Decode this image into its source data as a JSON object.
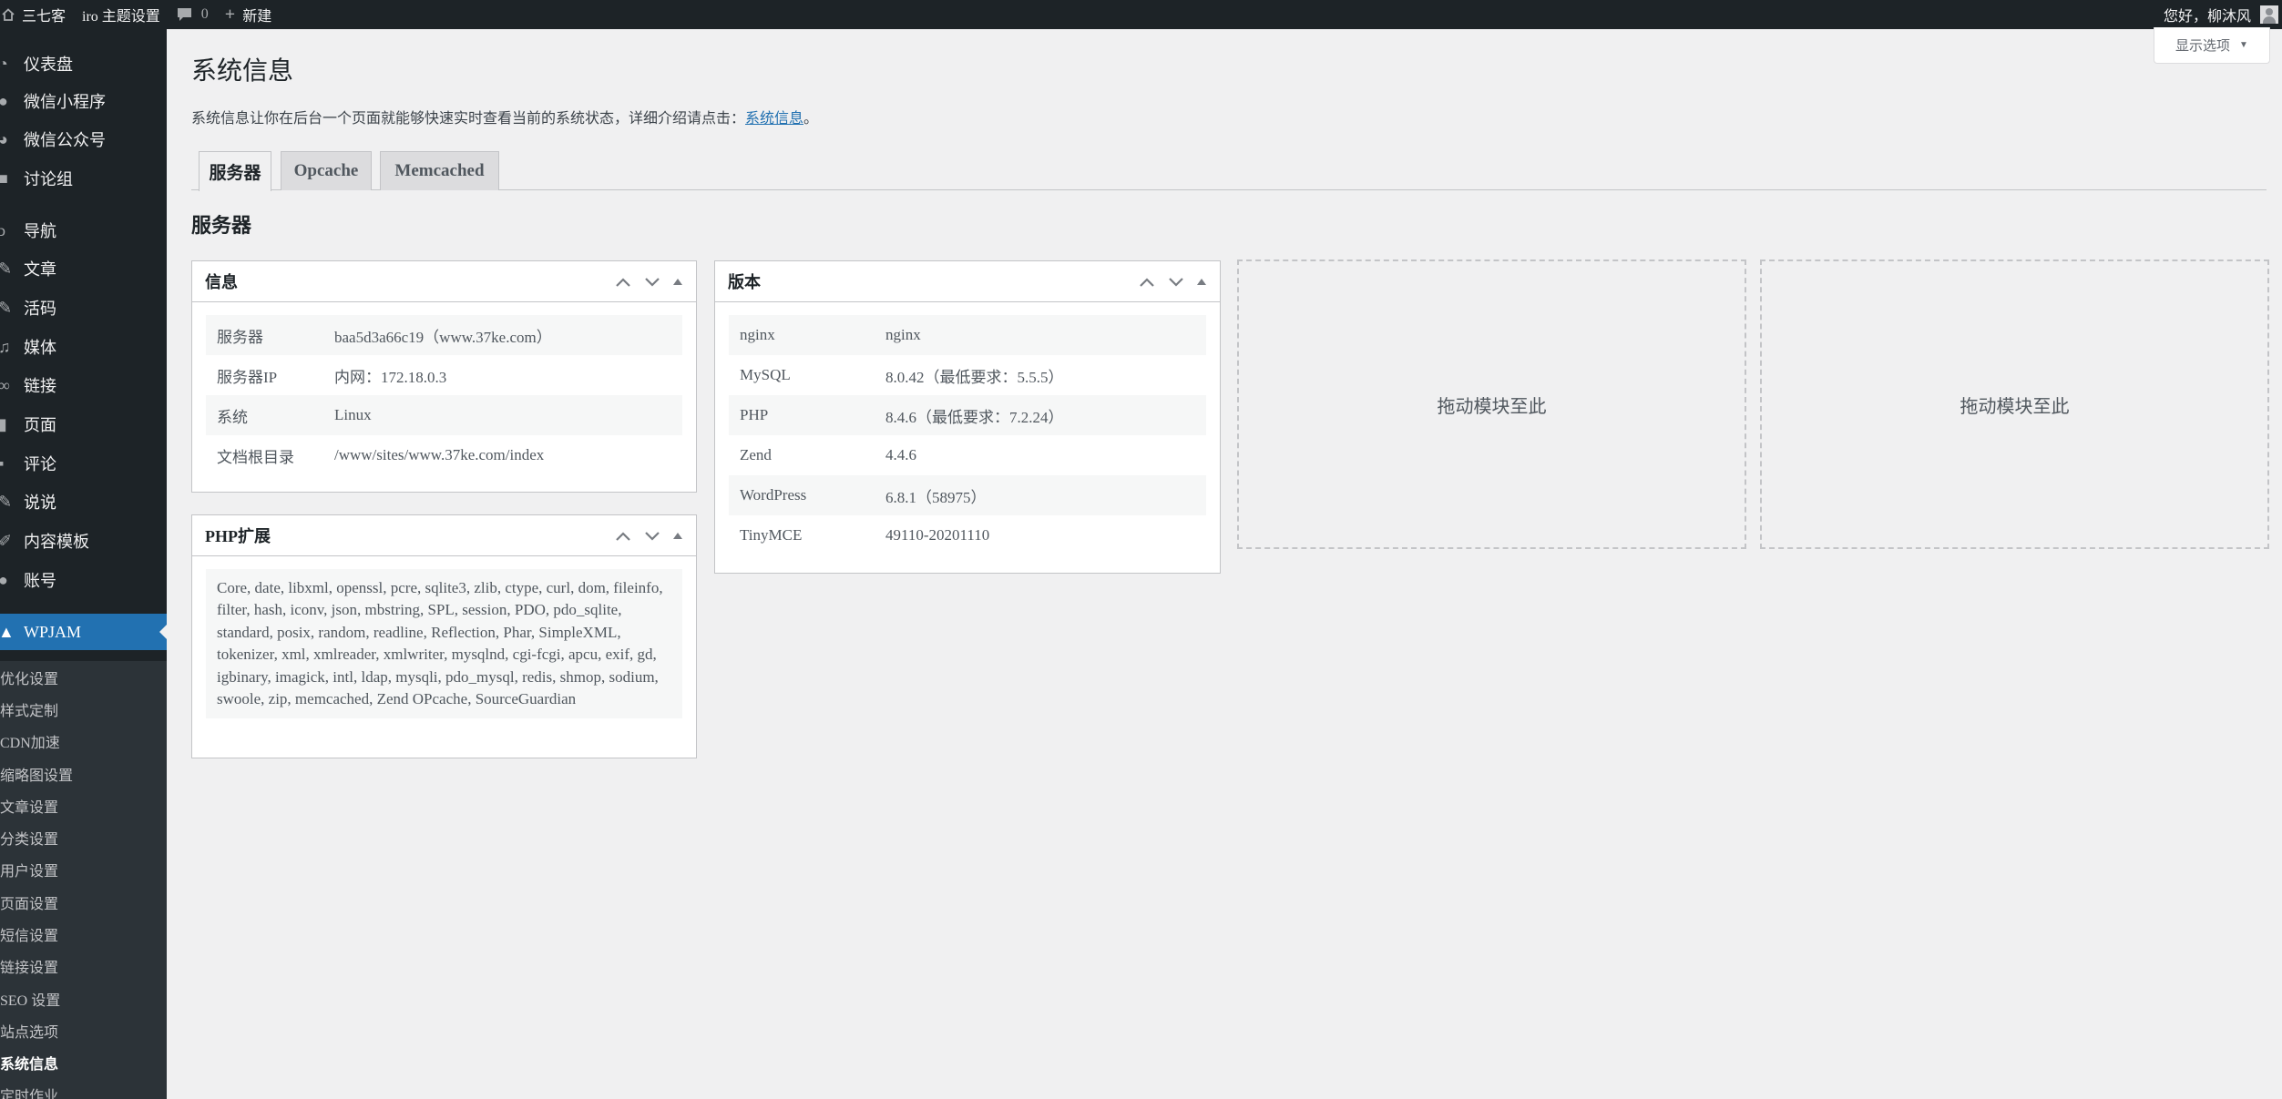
{
  "adminbar": {
    "site_name": "三七客",
    "theme_settings": "iro 主题设置",
    "comments_count": "0",
    "new_label": "新建",
    "greeting": "您好，柳沐风"
  },
  "sidebar": {
    "menu": [
      {
        "label": "仪表盘",
        "icon": "dashboard-icon"
      },
      {
        "label": "微信小程序",
        "icon": "weapp-icon"
      },
      {
        "label": "微信公众号",
        "icon": "wechat-icon"
      },
      {
        "label": "讨论组",
        "icon": "discussion-icon"
      },
      {
        "label": "导航",
        "icon": "navigation-icon"
      },
      {
        "label": "文章",
        "icon": "pin-icon"
      },
      {
        "label": "活码",
        "icon": "pin-icon"
      },
      {
        "label": "媒体",
        "icon": "media-icon"
      },
      {
        "label": "链接",
        "icon": "link-icon"
      },
      {
        "label": "页面",
        "icon": "page-icon"
      },
      {
        "label": "评论",
        "icon": "comment-icon"
      },
      {
        "label": "说说",
        "icon": "pin-icon"
      },
      {
        "label": "内容模板",
        "icon": "edit-icon"
      },
      {
        "label": "账号",
        "icon": "users-icon"
      },
      {
        "label": "WPJAM",
        "icon": "rocket-icon"
      }
    ],
    "submenu": [
      "优化设置",
      "样式定制",
      "CDN加速",
      "缩略图设置",
      "文章设置",
      "分类设置",
      "用户设置",
      "页面设置",
      "短信设置",
      "链接设置",
      "SEO 设置",
      "站点选项",
      "系统信息",
      "定时作业"
    ]
  },
  "screen_options": "显示选项",
  "page": {
    "title": "系统信息",
    "intro": "系统信息让你在后台一个页面就能够快速实时查看当前的系统状态，详细介绍请点击：",
    "intro_link": "系统信息",
    "intro_end": "。",
    "section_title": "服务器"
  },
  "tabs": [
    "服务器",
    "Opcache",
    "Memcached"
  ],
  "info_box": {
    "title": "信息",
    "rows": [
      {
        "k": "服务器",
        "v": "baa5d3a66c19（www.37ke.com）"
      },
      {
        "k": "服务器IP",
        "v": "内网：172.18.0.3"
      },
      {
        "k": "系统",
        "v": "Linux"
      },
      {
        "k": "文档根目录",
        "v": "/www/sites/www.37ke.com/index"
      }
    ]
  },
  "php_box": {
    "title": "PHP扩展",
    "extensions": "Core, date, libxml, openssl, pcre, sqlite3, zlib, ctype, curl, dom, fileinfo, filter, hash, iconv, json, mbstring, SPL, session, PDO, pdo_sqlite, standard, posix, random, readline, Reflection, Phar, SimpleXML, tokenizer, xml, xmlreader, xmlwriter, mysqlnd, cgi-fcgi, apcu, exif, gd, igbinary, imagick, intl, ldap, mysqli, pdo_mysql, redis, shmop, sodium, swoole, zip, memcached, Zend OPcache, SourceGuardian"
  },
  "version_box": {
    "title": "版本",
    "rows": [
      {
        "k": "nginx",
        "v": "nginx"
      },
      {
        "k": "MySQL",
        "v": "8.0.42（最低要求：5.5.5）"
      },
      {
        "k": "PHP",
        "v": "8.4.6（最低要求：7.2.24）"
      },
      {
        "k": "Zend",
        "v": "4.4.6"
      },
      {
        "k": "WordPress",
        "v": "6.8.1（58975）"
      },
      {
        "k": "TinyMCE",
        "v": "49110-20201110"
      }
    ]
  },
  "dropzones": [
    "拖动模块至此",
    "拖动模块至此"
  ]
}
